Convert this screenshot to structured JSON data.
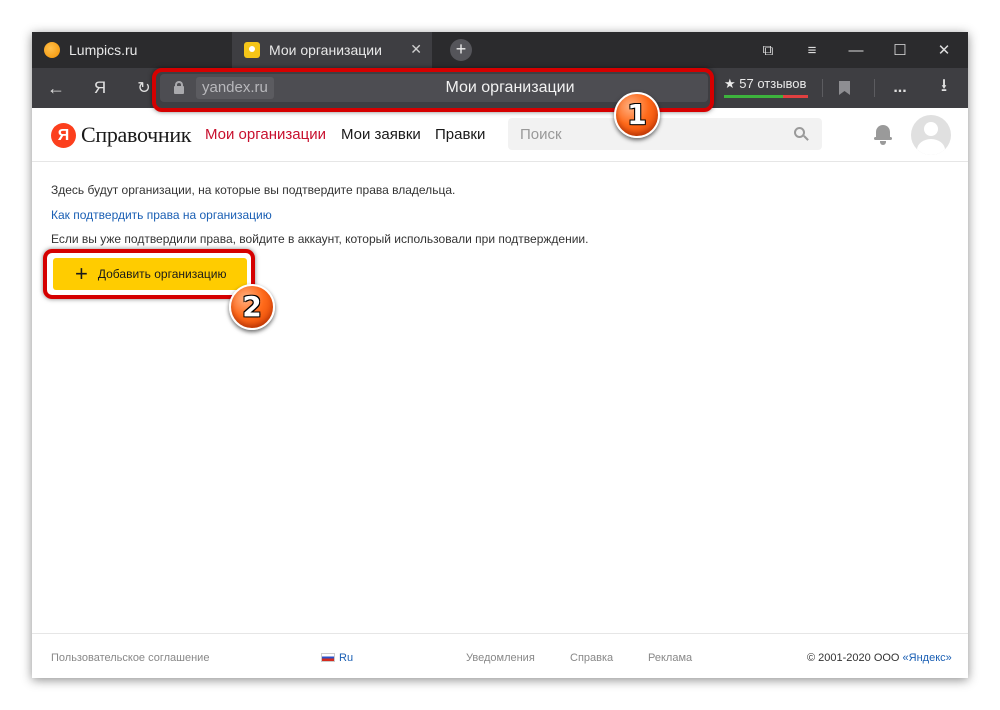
{
  "browser": {
    "tabs": [
      {
        "title": "Lumpics.ru",
        "active": false,
        "favicon": "orange-circle-favicon"
      },
      {
        "title": "Мои организации",
        "active": true,
        "favicon": "yandex-spravochnik-favicon"
      }
    ],
    "tab_close_glyph": "✕",
    "new_tab_glyph": "+",
    "window_controls": {
      "collections": "⧉",
      "menu": "≡",
      "minimize": "—",
      "maximize": "☐",
      "close": "✕"
    },
    "nav": {
      "back": "←",
      "yandex": "Я",
      "reload": "↻"
    },
    "address": {
      "domain": "yandex.ru",
      "page_title": "Мои организации"
    },
    "reviews": {
      "label": "★ 57 отзывов"
    },
    "toolbar": {
      "bookmark": "bookmark-icon",
      "more": "...",
      "download": "⭳"
    }
  },
  "site": {
    "logo_letter": "Я",
    "logo_text": "Справочник",
    "nav": [
      {
        "label": "Мои организации",
        "active": true
      },
      {
        "label": "Мои заявки",
        "active": false
      },
      {
        "label": "Правки",
        "active": false
      }
    ],
    "search_placeholder": "Поиск"
  },
  "main": {
    "intro": "Здесь будут организации, на которые вы подтвердите права владельца.",
    "how_to_link": "Как подтвердить права на организацию",
    "note": "Если вы уже подтвердили права, войдите в аккаунт, который использовали при подтверждении.",
    "add_button": {
      "icon": "+",
      "label": "Добавить организацию"
    }
  },
  "annotations": {
    "badge1": "1",
    "badge2": "2",
    "highlight_color": "#d50000",
    "badge_color": "#ff6a1a"
  },
  "footer": {
    "agreement": "Пользовательское соглашение",
    "language": "Ru",
    "notifications": "Уведомления",
    "help": "Справка",
    "ads": "Реклама",
    "copyright_prefix": "© 2001-2020 ООО ",
    "copyright_link": "«Яндекс»"
  },
  "colors": {
    "accent_red": "#c8102e",
    "button_yellow": "#ffcc00",
    "link_blue": "#1a5fb4",
    "yandex_red": "#fc3f1d"
  }
}
